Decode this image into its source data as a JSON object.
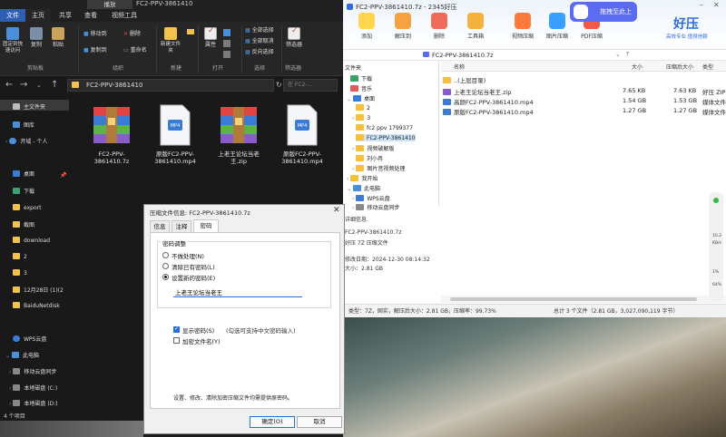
{
  "explorer": {
    "title": "FC2-PPV-3861410",
    "play_tab": "播放",
    "tabs": [
      "文件",
      "主页",
      "共享",
      "查看",
      "视频工具"
    ],
    "ribbon": {
      "pin": "固定到快速访问",
      "copy": "复制",
      "paste": "粘贴",
      "move_to": "移动到",
      "copy_to": "复制到",
      "delete": "删除",
      "rename": "重命名",
      "new_folder": "新建文件夹",
      "properties": "属性",
      "select_all": "全部选择",
      "select_none": "全部取消",
      "invert": "反向选择",
      "filter": "筛选器",
      "groups": [
        "剪贴板",
        "组织",
        "新建",
        "打开",
        "选择",
        "筛选器"
      ]
    },
    "address": "FC2-PPV-3861410",
    "search_placeholder": "在 FC2-...",
    "nav": [
      "主文件夹",
      "图库",
      "开域 - 个人",
      "桌面",
      "下载",
      "export",
      "截图",
      "download",
      "2",
      "3",
      "12月28日 (1)(2",
      "BaiduNetdisk",
      "WPS云盘",
      "此电脑",
      "移动云盘同步",
      "本地磁盘 (C:)",
      "本地磁盘 (D:)"
    ],
    "files": [
      {
        "name": "FC2-PPV-3861410.7z",
        "type": "zip"
      },
      {
        "name": "原版FC2-PPV-3861410.mp4",
        "type": "mp4"
      },
      {
        "name": "上老王论坛当老王.zip",
        "type": "zip"
      },
      {
        "name": "原版FC2-PPV-3861410.mp4",
        "type": "mp4"
      }
    ],
    "status": "4 个项目"
  },
  "haozip": {
    "title": "FC2-PPV-3861410.7z - 2345好压",
    "toolbar": [
      "添加",
      "解压到",
      "删除",
      "工具箱",
      "视频压缩",
      "图片压缩",
      "PDF压缩"
    ],
    "drag_button": "拖拽至此上",
    "brand": "好压",
    "slogan": "高效专业 值得信赖",
    "path": "FC2-PPV-3861410.7z",
    "tree_header": "文件夹",
    "tree": [
      "下载",
      "音乐",
      "桌面",
      "2",
      "3",
      "fc2 ppv 1799377",
      "FC2-PPV-3861410",
      "视频破解版",
      "刘小冉",
      "图片音视频处理",
      "我开始",
      "此电脑",
      "WPS云盘",
      "移动云盘同步"
    ],
    "info_header": "详细信息",
    "info": [
      "FC2-PPV-3861410.7z",
      "好压 7Z 压缩文件",
      "修改日期：2024-12-30 08:14:32",
      "大小：2.81 GB"
    ],
    "columns": [
      "名称",
      "大小",
      "压缩后大小",
      "类型"
    ],
    "rows": [
      {
        "name": "..(上层目录)",
        "size": "",
        "packed": "",
        "type": ""
      },
      {
        "name": "上老王论坛当老王.zip",
        "size": "7.65 KB",
        "packed": "7.63 KB",
        "type": "好压 ZIP"
      },
      {
        "name": "高颜FC2-PPV-3861410.mp4",
        "size": "1.54 GB",
        "packed": "1.53 GB",
        "type": "媒体文件"
      },
      {
        "name": "原版FC2-PPV-3861410.mp4",
        "size": "1.27 GB",
        "packed": "1.27 GB",
        "type": "媒体文件"
      }
    ],
    "status": {
      "left": "类型：7Z，固实，解压后大小：2.81 GB，压缩率：99.73%",
      "right": "总计 3 个文件（2.81 GB，3,027,090,119 字节）"
    }
  },
  "dialog": {
    "title": "压缩文件信息: FC2-PPV-3861410.7z",
    "close": "✕",
    "tabs": [
      "信息",
      "注释",
      "密码"
    ],
    "group_label": "密码调整",
    "options": [
      "不做处理(N)",
      "清除已有密码(L)",
      "设置新的密码(E)"
    ],
    "password": "上老王论坛当老王",
    "show_password": "显示密码(S)",
    "show_hint": "(勾选可支持中文密码输入)",
    "encrypt_names": "加密文件名(Y)",
    "note": "设置、修改、清除加密压缩文件均需提供原密码。",
    "ok": "确定(O)",
    "cancel": "取消"
  },
  "widget": [
    "10.2",
    "KB/s",
    "1%",
    "64%"
  ]
}
